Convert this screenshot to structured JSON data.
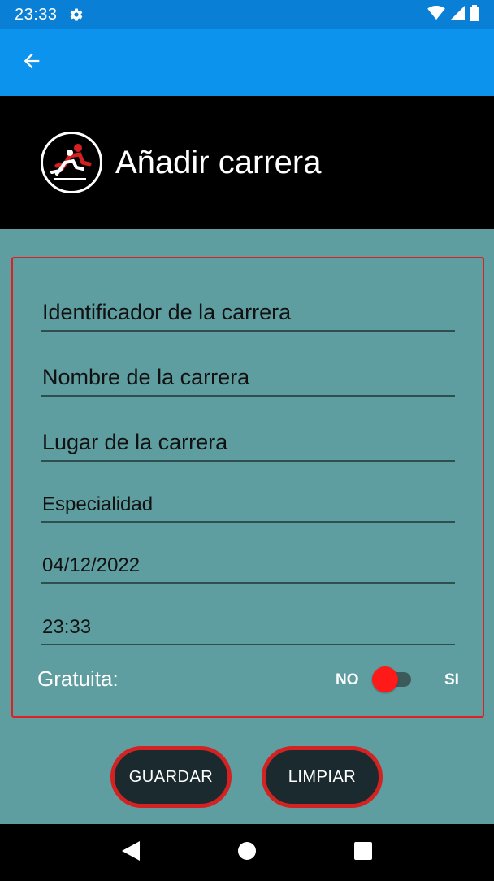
{
  "status_bar": {
    "time": "23:33",
    "icons": [
      "gear-icon",
      "wifi-icon",
      "signal-icon",
      "battery-icon"
    ]
  },
  "app_bar": {
    "back_icon": "arrow-left-icon"
  },
  "header": {
    "title": "Añadir carrera",
    "logo_icon": "runners-logo-icon"
  },
  "form": {
    "id_placeholder": "Identificador de la carrera",
    "name_placeholder": "Nombre de la carrera",
    "place_placeholder": "Lugar de la carrera",
    "specialty": "Especialidad",
    "date": "04/12/2022",
    "time": "23:33",
    "gratuita_label": "Gratuita:",
    "toggle_off_label": "NO",
    "toggle_on_label": "SI",
    "toggle_checked": false
  },
  "buttons": {
    "save": "GUARDAR",
    "clear": "LIMPIAR"
  },
  "colors": {
    "status_bar": "#0a7fd6",
    "app_bar": "#0b93ee",
    "header": "#000000",
    "background": "#5f9ea0",
    "accent_red": "#d32222",
    "button_fill": "#1b2a2e"
  },
  "nav_bar": {
    "icons": [
      "back-triangle-icon",
      "home-circle-icon",
      "recents-square-icon"
    ]
  }
}
